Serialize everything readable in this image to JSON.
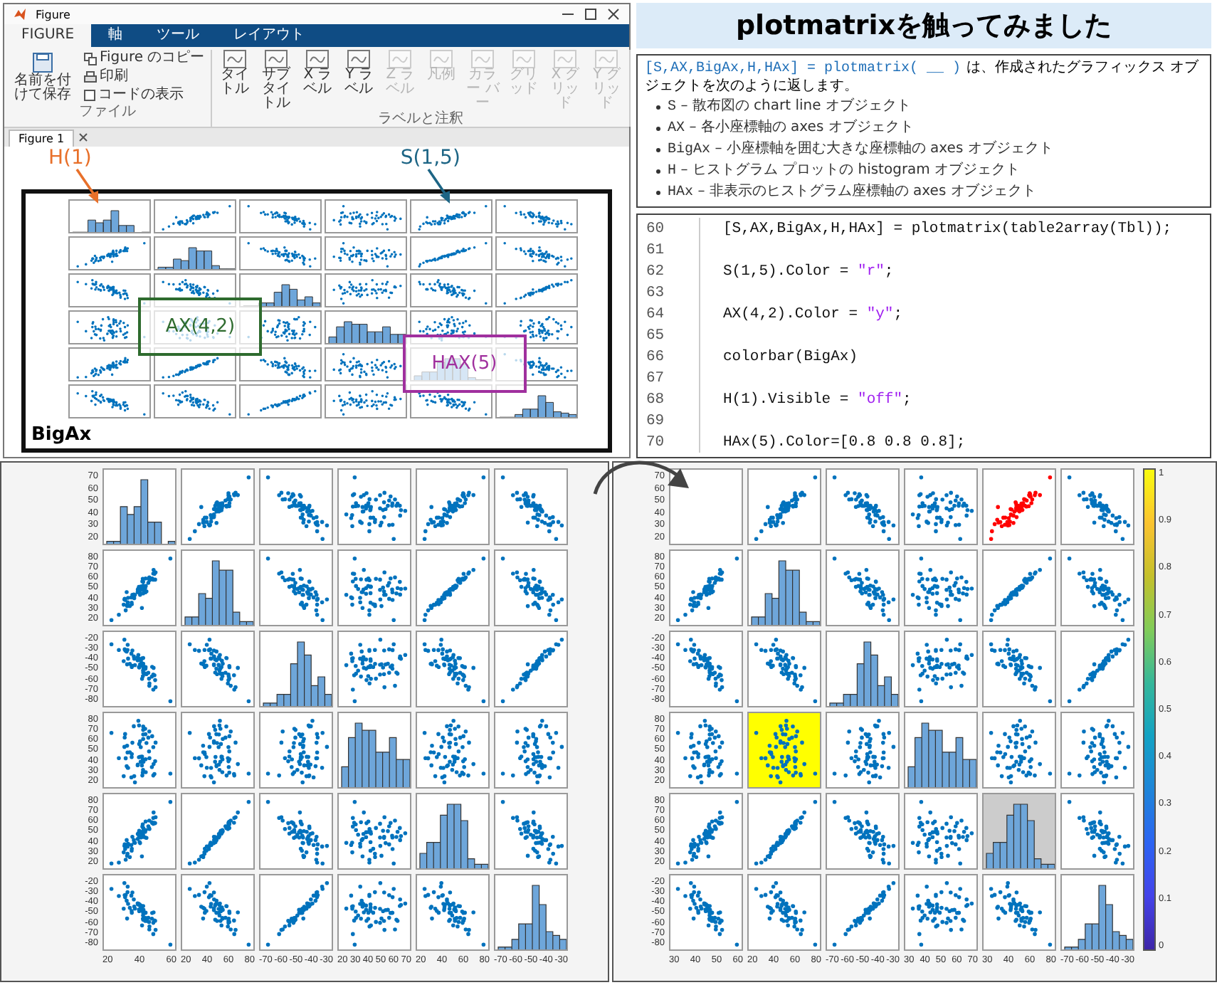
{
  "figure_window": {
    "title": "Figure",
    "tabs": [
      {
        "label": "FIGURE",
        "selected": true
      },
      {
        "label": "軸",
        "selected": false
      },
      {
        "label": "ツール",
        "selected": false
      },
      {
        "label": "レイアウト",
        "selected": false
      }
    ],
    "file_group": {
      "label": "ファイル",
      "items": [
        {
          "kind": "large",
          "label": "名前を付けて保存"
        },
        {
          "kind": "small",
          "label": "Figure のコピー"
        },
        {
          "kind": "small",
          "label": "印刷"
        },
        {
          "kind": "checkbox",
          "label": "コードの表示",
          "checked": false
        }
      ]
    },
    "label_group": {
      "label": "ラベルと注釈",
      "items": [
        {
          "label": "タイトル",
          "disabled": false
        },
        {
          "label": "サブタイトル",
          "disabled": false
        },
        {
          "label": "X ラベル",
          "disabled": false
        },
        {
          "label": "Y ラベル",
          "disabled": false
        },
        {
          "label": "Z ラベル",
          "disabled": true
        },
        {
          "label": "凡例",
          "disabled": true
        },
        {
          "label": "カラー バー",
          "disabled": true
        },
        {
          "label": "グリッド",
          "disabled": true
        },
        {
          "label": "X グリッド",
          "disabled": true
        },
        {
          "label": "Y グリッド",
          "disabled": true
        }
      ]
    },
    "document_tab": "Figure 1",
    "matrix": {
      "frame_label": "BigAx",
      "annotations": [
        {
          "kind": "arrow_label",
          "label": "H(1)",
          "color": "#e8702a"
        },
        {
          "kind": "arrow_label",
          "label": "S(1,5)",
          "color": "#1d6585"
        },
        {
          "kind": "box_label",
          "label": "AX(4,2)",
          "color": "#2e6b2e"
        },
        {
          "kind": "box_label",
          "label": "HAX(5)",
          "color": "#a0309e"
        }
      ]
    }
  },
  "heading": "plotmatrixを触ってみました",
  "description": {
    "code": "[S,AX,BigAx,H,HAx] = plotmatrix( __ )",
    "text": "は、作成されたグラフィックス オブジェクトを次のように返します。",
    "items": [
      {
        "term": "S",
        "text": "– 散布図の chart line オブジェクト"
      },
      {
        "term": "AX",
        "text": "– 各小座標軸の axes オブジェクト"
      },
      {
        "term": "BigAx",
        "text": "– 小座標軸を囲む大きな座標軸の axes オブジェクト"
      },
      {
        "term": "H",
        "text": "– ヒストグラム プロットの histogram オブジェクト"
      },
      {
        "term": "HAx",
        "text": "– 非表示のヒストグラム座標軸の axes オブジェクト"
      }
    ]
  },
  "code": [
    {
      "number": "60",
      "tokens": [
        {
          "kind": "plain",
          "text": "[S,AX,BigAx,H,HAx] = plotmatrix(table2array(Tbl));"
        }
      ]
    },
    {
      "number": "61"
    },
    {
      "number": "62",
      "tokens": [
        {
          "kind": "plain",
          "text": "S(1,5).Color = "
        },
        {
          "kind": "string",
          "text": "\"r\""
        },
        {
          "kind": "plain",
          "text": ";"
        }
      ]
    },
    {
      "number": "63"
    },
    {
      "number": "64",
      "tokens": [
        {
          "kind": "plain",
          "text": "AX(4,2).Color = "
        },
        {
          "kind": "string",
          "text": "\"y\""
        },
        {
          "kind": "plain",
          "text": ";"
        }
      ]
    },
    {
      "number": "65"
    },
    {
      "number": "66",
      "tokens": [
        {
          "kind": "plain",
          "text": "colorbar(BigAx)"
        }
      ]
    },
    {
      "number": "67"
    },
    {
      "number": "68",
      "tokens": [
        {
          "kind": "plain",
          "text": "H(1).Visible = "
        },
        {
          "kind": "string",
          "text": "\"off\""
        },
        {
          "kind": "plain",
          "text": ";"
        }
      ]
    },
    {
      "number": "69"
    },
    {
      "number": "70",
      "tokens": [
        {
          "kind": "plain",
          "text": "HAx(5).Color=[0.8 0.8 0.8];"
        }
      ]
    }
  ],
  "result_panels": [
    {
      "y_ticks": [
        [
          "70",
          "60",
          "50",
          "40",
          "30",
          "20"
        ],
        [
          "80",
          "70",
          "60",
          "50",
          "40",
          "30",
          "20"
        ],
        [
          "-20",
          "-30",
          "-40",
          "-50",
          "-60",
          "-70",
          "-80"
        ],
        [
          "80",
          "70",
          "60",
          "50",
          "40",
          "30",
          "20"
        ],
        [
          "80",
          "70",
          "60",
          "50",
          "40",
          "30",
          "20"
        ],
        [
          "-20",
          "-30",
          "-40",
          "-50",
          "-60",
          "-70",
          "-80"
        ]
      ],
      "x_ticks": [
        [
          "20",
          "40",
          "60"
        ],
        [
          "20",
          "40",
          "60",
          "80"
        ],
        [
          "-70",
          "-60",
          "-50",
          "-40",
          "-30"
        ],
        [
          "20",
          "30",
          "40",
          "50",
          "60",
          "70"
        ],
        [
          "20",
          "40",
          "60",
          "80"
        ],
        [
          "-70",
          "-60",
          "-50",
          "-40",
          "-30"
        ]
      ]
    },
    {
      "y_ticks": [
        [
          "70",
          "60",
          "50",
          "40",
          "30",
          "20"
        ],
        [
          "80",
          "70",
          "60",
          "50",
          "40",
          "30",
          "20"
        ],
        [
          "-20",
          "-30",
          "-40",
          "-50",
          "-60",
          "-70",
          "-80"
        ],
        [
          "80",
          "70",
          "60",
          "50",
          "40",
          "30",
          "20"
        ],
        [
          "80",
          "70",
          "60",
          "50",
          "40",
          "30",
          "20"
        ],
        [
          "-20",
          "-30",
          "-40",
          "-50",
          "-60",
          "-70",
          "-80"
        ]
      ],
      "x_ticks": [
        [
          "30",
          "40",
          "50",
          "60"
        ],
        [
          "20",
          "40",
          "60",
          "80"
        ],
        [
          "-70",
          "-60",
          "-50",
          "-40",
          "-30"
        ],
        [
          "30",
          "40",
          "50",
          "60",
          "70"
        ],
        [
          "30",
          "40",
          "60",
          "80"
        ],
        [
          "-70",
          "-60",
          "-50",
          "-40",
          "-30"
        ]
      ],
      "modifications": [
        {
          "kind": "scatter_color",
          "color": "#ff0000"
        },
        {
          "kind": "axes_color",
          "color": "#ffff00"
        },
        {
          "kind": "hist_hidden"
        },
        {
          "kind": "hist_axes_color",
          "color": "#cccccc"
        }
      ],
      "colorbar": {
        "ticks": [
          "1",
          "0.9",
          "0.8",
          "0.7",
          "0.6",
          "0.5",
          "0.4",
          "0.3",
          "0.2",
          "0.1",
          "0"
        ]
      }
    }
  ]
}
